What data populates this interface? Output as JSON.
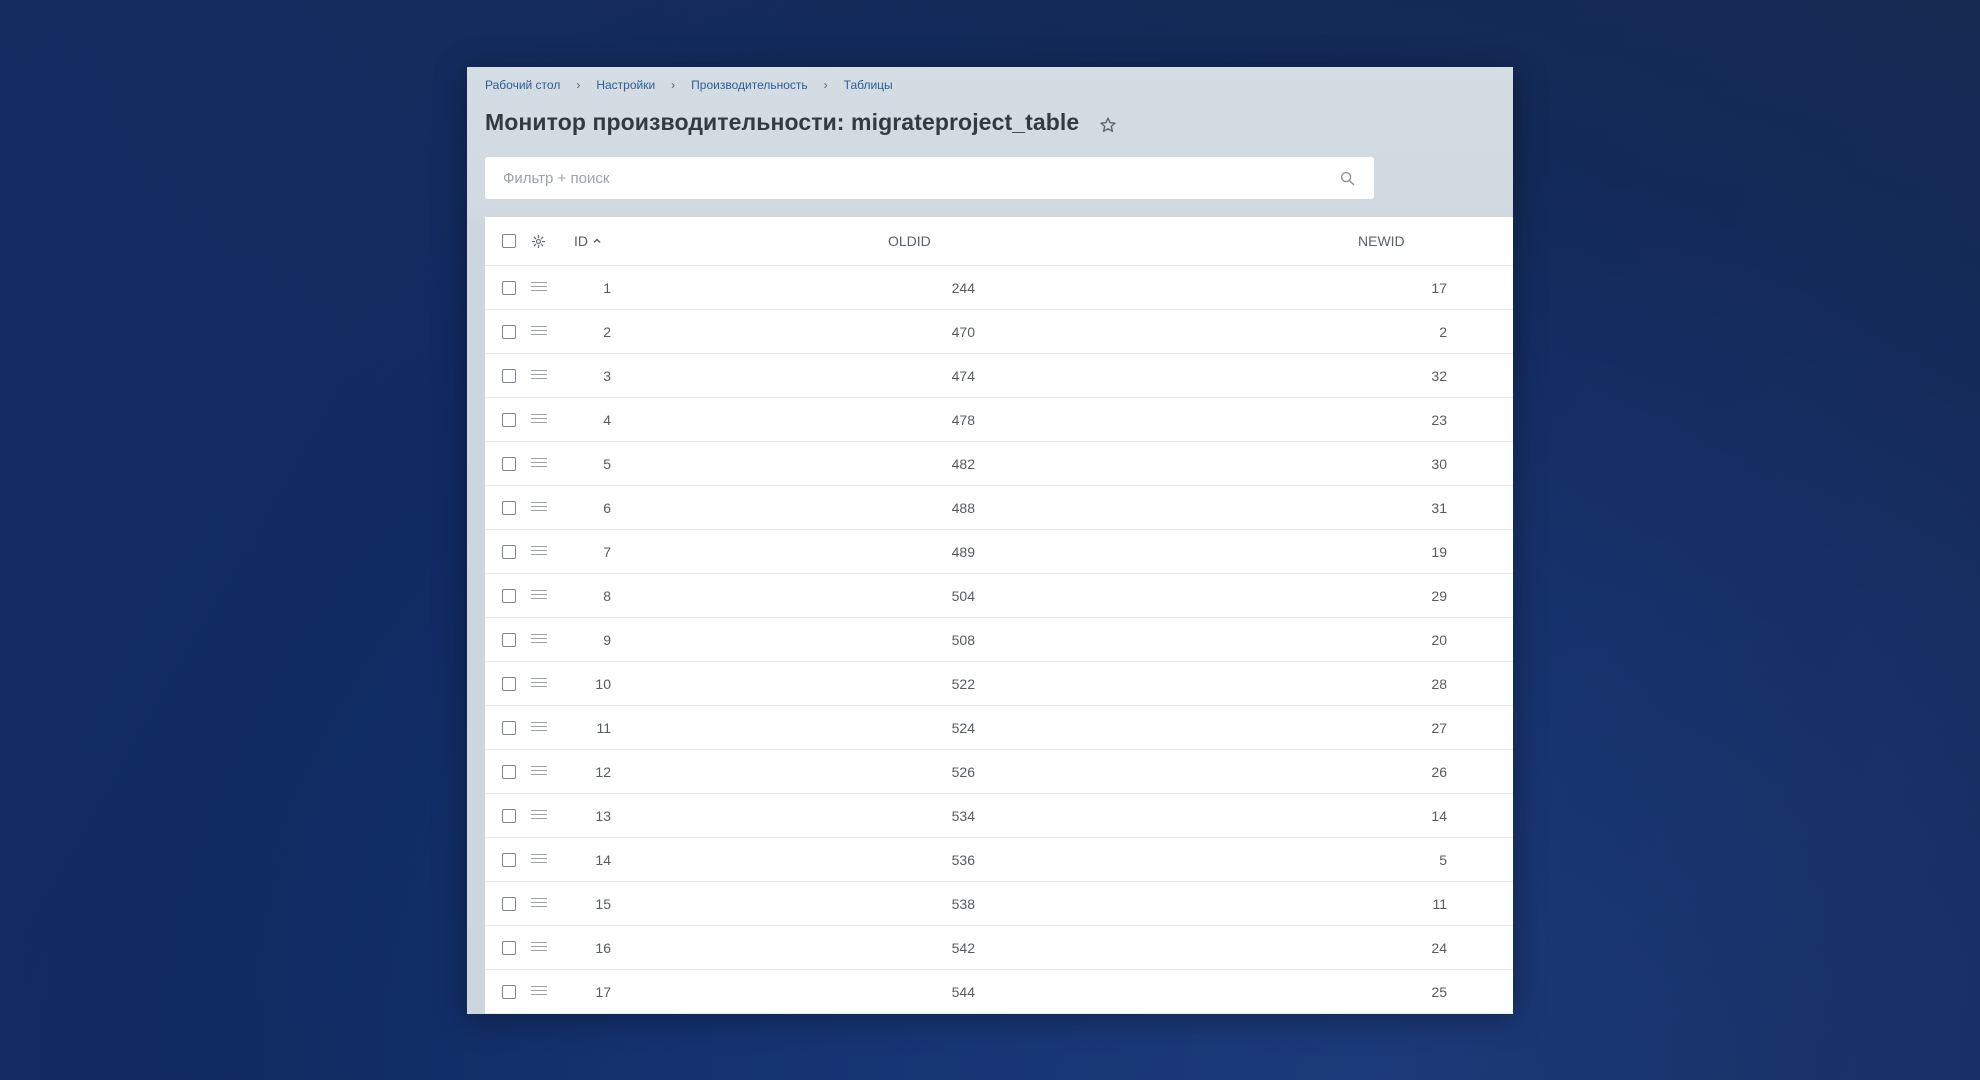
{
  "breadcrumb": [
    "Рабочий стол",
    "Настройки",
    "Производительность",
    "Таблицы"
  ],
  "page": {
    "title": "Монитор производительности: migrateproject_table"
  },
  "search": {
    "placeholder": "Фильтр + поиск",
    "value": ""
  },
  "table": {
    "columns": [
      "ID",
      "OLDID",
      "NEWID"
    ],
    "sort": {
      "column": "ID",
      "direction": "asc"
    },
    "rows": [
      {
        "id": "1",
        "oldid": "244",
        "newid": "17"
      },
      {
        "id": "2",
        "oldid": "470",
        "newid": "2"
      },
      {
        "id": "3",
        "oldid": "474",
        "newid": "32"
      },
      {
        "id": "4",
        "oldid": "478",
        "newid": "23"
      },
      {
        "id": "5",
        "oldid": "482",
        "newid": "30"
      },
      {
        "id": "6",
        "oldid": "488",
        "newid": "31"
      },
      {
        "id": "7",
        "oldid": "489",
        "newid": "19"
      },
      {
        "id": "8",
        "oldid": "504",
        "newid": "29"
      },
      {
        "id": "9",
        "oldid": "508",
        "newid": "20"
      },
      {
        "id": "10",
        "oldid": "522",
        "newid": "28"
      },
      {
        "id": "11",
        "oldid": "524",
        "newid": "27"
      },
      {
        "id": "12",
        "oldid": "526",
        "newid": "26"
      },
      {
        "id": "13",
        "oldid": "534",
        "newid": "14"
      },
      {
        "id": "14",
        "oldid": "536",
        "newid": "5"
      },
      {
        "id": "15",
        "oldid": "538",
        "newid": "11"
      },
      {
        "id": "16",
        "oldid": "542",
        "newid": "24"
      },
      {
        "id": "17",
        "oldid": "544",
        "newid": "25"
      }
    ]
  },
  "icons": {
    "favorite": "star-icon",
    "search": "search-icon",
    "settings": "gear-icon",
    "row_menu": "menu-icon",
    "sort": "chevron-up-icon"
  },
  "colors": {
    "link": "#2f5c96",
    "title": "#333b42",
    "header_bg": "#cfd9df",
    "background": "#13306a"
  }
}
